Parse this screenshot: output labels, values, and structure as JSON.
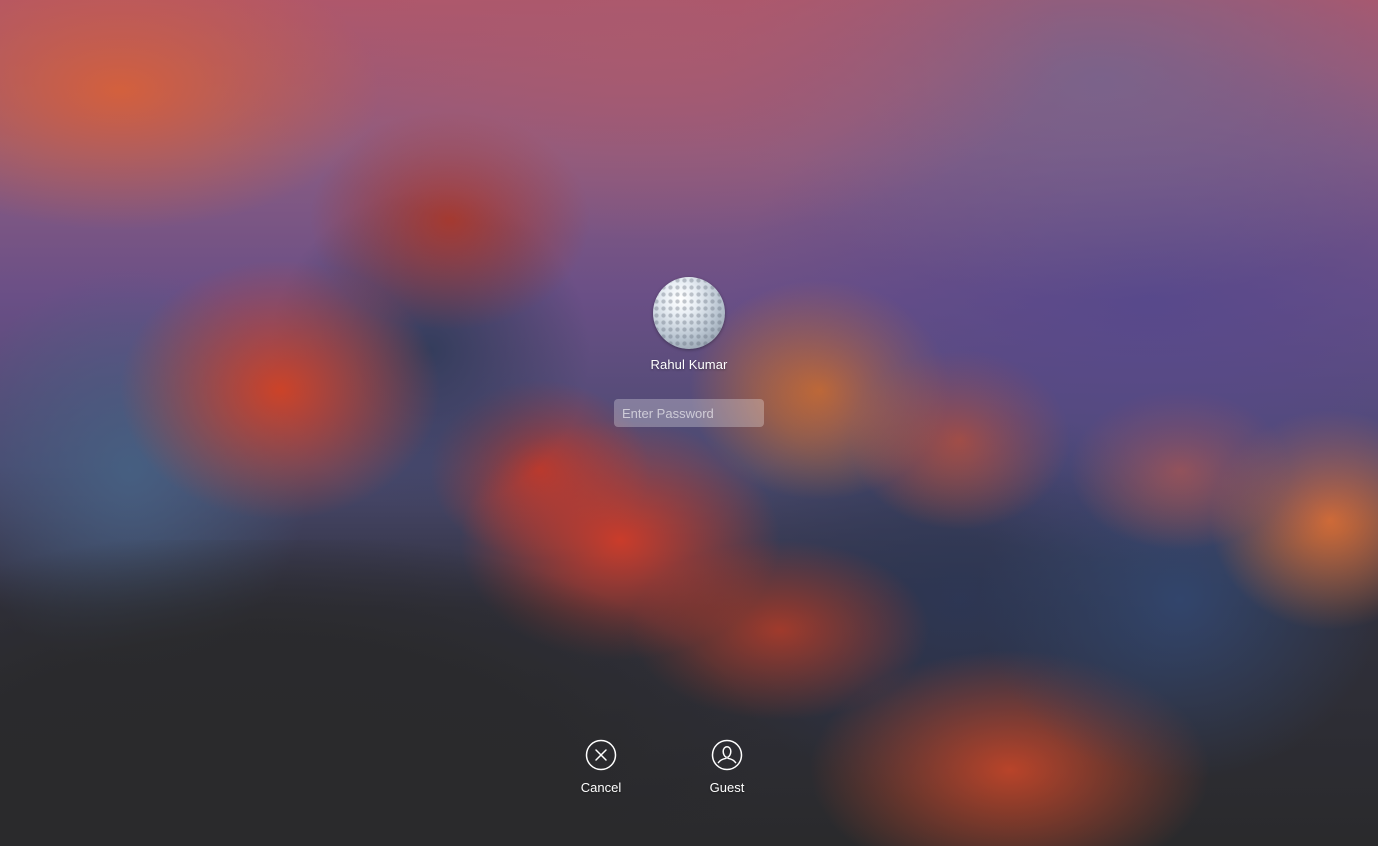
{
  "screen": {
    "type": "macOS login window"
  },
  "user": {
    "name": "Rahul Kumar",
    "avatar_icon": "golf-ball-avatar"
  },
  "password": {
    "placeholder": "Enter Password",
    "value": ""
  },
  "actions": {
    "cancel": {
      "label": "Cancel",
      "icon": "close-circle-icon"
    },
    "guest": {
      "label": "Guest",
      "icon": "user-circle-icon"
    }
  },
  "colors": {
    "background_bottom": "#2a2a2c",
    "text": "#ffffff"
  }
}
